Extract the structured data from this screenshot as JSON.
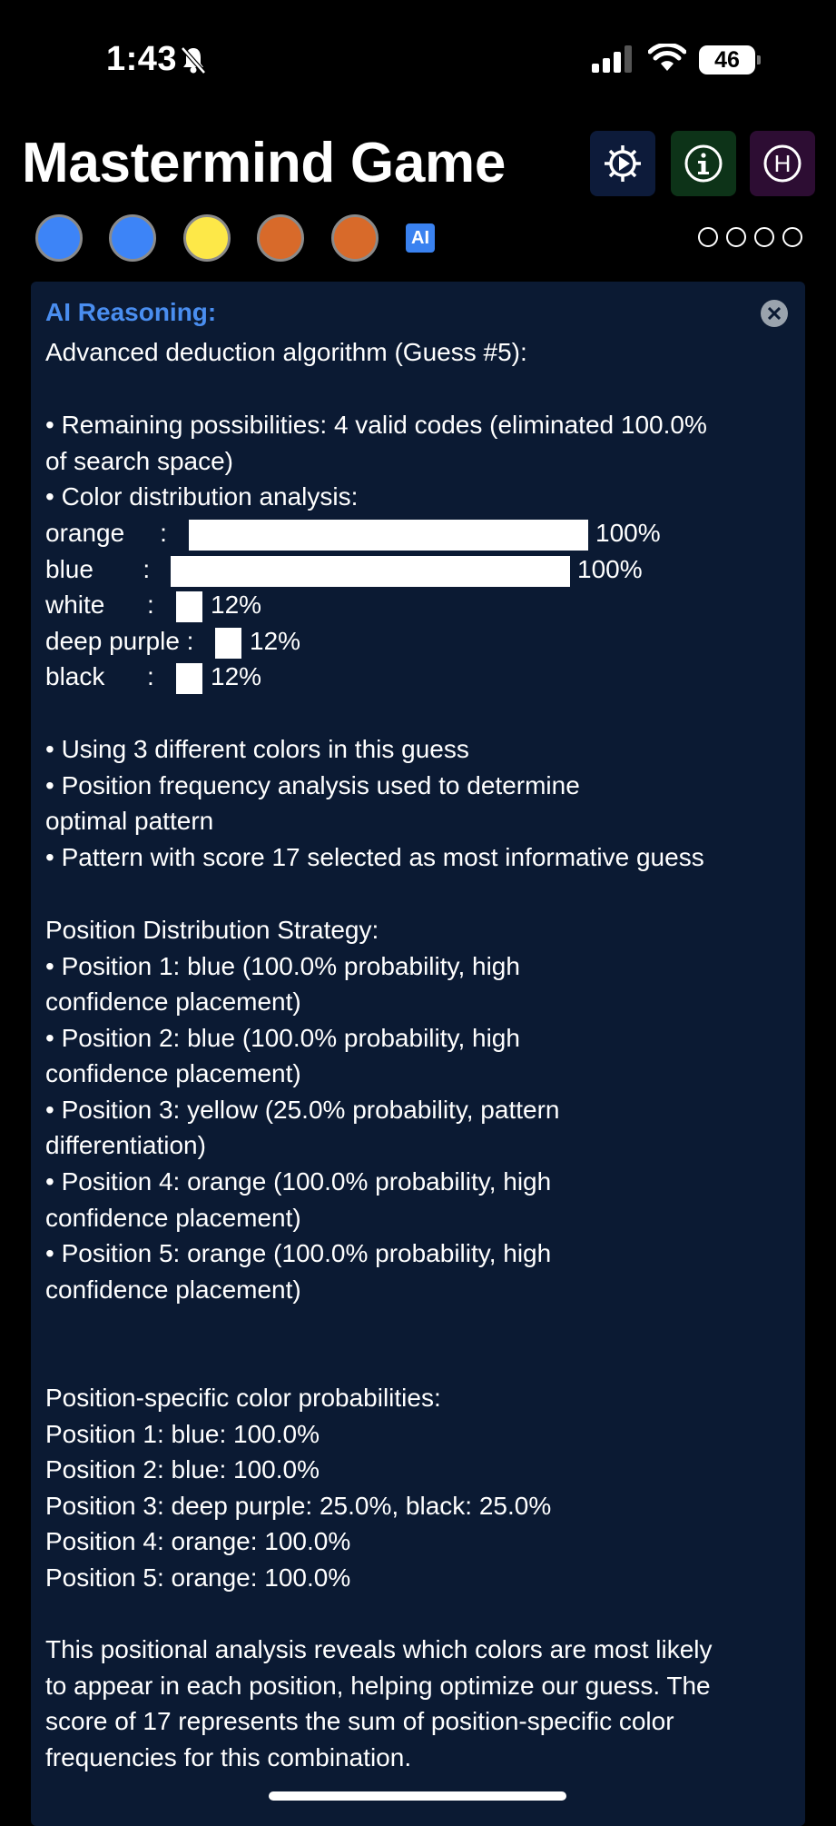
{
  "status_bar": {
    "time": "1:43",
    "battery": "46"
  },
  "header": {
    "title": "Mastermind Game",
    "buttons": {
      "settings": "settings-icon",
      "info": "info-icon",
      "hint": "H"
    }
  },
  "guess_row": {
    "pegs": [
      "#3d84f7",
      "#3d84f7",
      "#fde848",
      "#d86a2a",
      "#d86a2a"
    ],
    "ai_badge": "AI",
    "feedback_empty_count": 4
  },
  "reasoning": {
    "title": "AI Reasoning:",
    "intro": "Advanced deduction algorithm (Guess #5):",
    "possibilities_l1": "• Remaining possibilities: 4 valid codes (eliminated 100.0%",
    "possibilities_l2": "of search space)",
    "distribution_heading": "• Color distribution analysis:",
    "distribution": [
      {
        "label": "orange     :",
        "percent_text": "100%",
        "fraction": 1.0
      },
      {
        "label": "blue       :",
        "percent_text": "100%",
        "fraction": 1.0
      },
      {
        "label": "white      :",
        "percent_text": "12%",
        "fraction": 0.12
      },
      {
        "label": "deep purple :",
        "percent_text": "12%",
        "fraction": 0.12
      },
      {
        "label": "black      :",
        "percent_text": "12%",
        "fraction": 0.12
      }
    ],
    "bullets": [
      "• Using 3 different colors in this guess",
      "• Position frequency analysis used to determine",
      "optimal pattern",
      "• Pattern with score 17 selected as most informative guess"
    ],
    "strategy_heading": "Position Distribution Strategy:",
    "strategy": [
      "• Position 1: blue (100.0% probability, high",
      "confidence placement)",
      "• Position 2: blue (100.0% probability, high",
      "confidence placement)",
      "• Position 3: yellow (25.0% probability, pattern",
      "differentiation)",
      "• Position 4: orange (100.0% probability, high",
      "confidence placement)",
      "• Position 5: orange (100.0% probability, high",
      "confidence placement)"
    ],
    "probabilities_heading": "Position-specific color probabilities:",
    "probabilities": [
      "Position 1: blue: 100.0%",
      "Position 2: blue: 100.0%",
      "Position 3: deep purple: 25.0%, black: 25.0%",
      "Position 4: orange: 100.0%",
      "Position 5: orange: 100.0%"
    ],
    "conclusion": [
      "This positional analysis reveals which colors are most likely",
      "to appear in each position, helping optimize our guess. The",
      "score of 17 represents the sum of position-specific color",
      "frequencies for this combination."
    ]
  }
}
